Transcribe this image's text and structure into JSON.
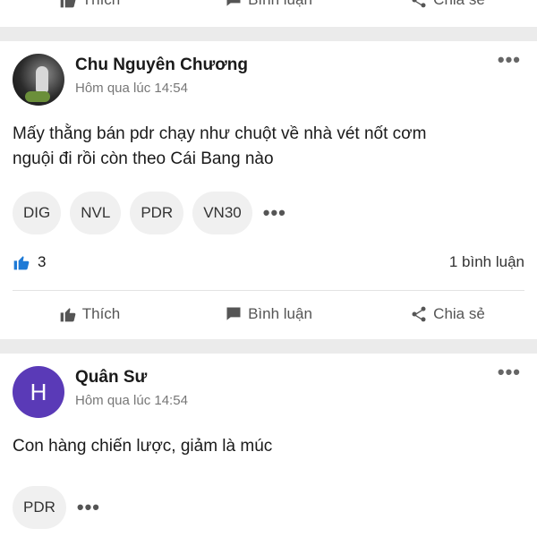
{
  "top_actions": {
    "like": "Thích",
    "comment": "Bình luận",
    "share": "Chia sẻ"
  },
  "posts": [
    {
      "author": "Chu Nguyên Chương",
      "time": "Hôm qua lúc 14:54",
      "content_line1": "Mấy thằng bán pdr chạy như chuột về nhà vét nốt cơm",
      "content_line2": "nguội đi rồi còn theo Cái Bang nào",
      "tags": [
        "DIG",
        "NVL",
        "PDR",
        "VN30"
      ],
      "likes": "3",
      "comments": "1 bình luận",
      "actions": {
        "like": "Thích",
        "comment": "Bình luận",
        "share": "Chia sẻ"
      }
    },
    {
      "author": "Quân Sư",
      "avatar_letter": "H",
      "time": "Hôm qua lúc 14:54",
      "content": "Con hàng chiến lược, giảm là múc",
      "tags": [
        "PDR"
      ]
    }
  ],
  "colors": {
    "like_blue": "#1e7ad6",
    "avatar_purple": "#5a3ab7",
    "divider": "#ebebeb"
  },
  "icons": [
    "thumbs-up-icon",
    "chat-icon",
    "share-icon",
    "more-icon"
  ]
}
